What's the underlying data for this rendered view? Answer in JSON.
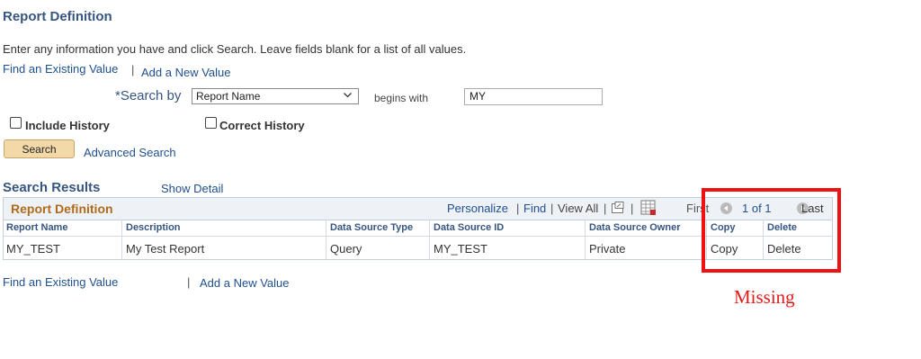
{
  "page": {
    "title": "Report Definition",
    "instructions": "Enter any information you have and click Search. Leave fields blank for a list of all values."
  },
  "nav_links": {
    "find_existing": "Find an Existing Value",
    "separator": "|",
    "add_new": "Add a New Value"
  },
  "search_form": {
    "search_by_label": "*Search by",
    "search_by_value": "Report Name",
    "operator": "begins with",
    "search_value": "MY",
    "include_history": "Include History",
    "correct_history": "Correct History",
    "search_button": "Search",
    "advanced_search": "Advanced Search"
  },
  "results": {
    "title": "Search Results",
    "show_detail": "Show Detail",
    "grid_title": "Report Definition",
    "toolbar": {
      "personalize": "Personalize",
      "find": "Find",
      "view_all": "View All",
      "sep": "|",
      "first": "First",
      "page_info": "1 of 1",
      "last": "Last"
    },
    "columns": [
      "Report Name",
      "Description",
      "Data Source Type",
      "Data Source ID",
      "Data Source Owner",
      "Copy",
      "Delete"
    ],
    "rows": [
      [
        "MY_TEST",
        "My Test Report",
        "Query",
        "MY_TEST",
        "Private",
        "Copy",
        "Delete"
      ]
    ]
  },
  "footer_links": {
    "find_existing": "Find an Existing Value",
    "separator": "|",
    "add_new": "Add a New Value"
  },
  "annotation": {
    "text": "Missing",
    "color": "#ee1111"
  }
}
